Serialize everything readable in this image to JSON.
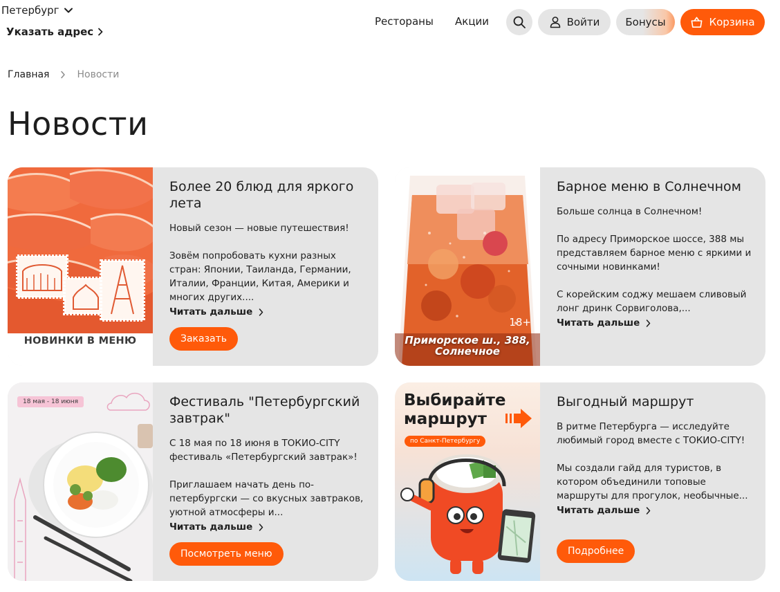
{
  "header": {
    "city": "Петербург",
    "address_link": "Указать адрес",
    "nav": {
      "restaurants": "Рестораны",
      "promos": "Акции"
    },
    "login": "Войти",
    "bonuses": "Бонусы",
    "cart": "Корзина"
  },
  "breadcrumb": {
    "home": "Главная",
    "current": "Новости"
  },
  "page_title": "Новости",
  "cards": [
    {
      "title": "Более 20 блюд для яркого лета",
      "paragraphs": [
        "Новый сезон — новые путешествия!",
        "Зовём попробовать кухни разных стран: Японии, Таиланда, Германии, Италии, Франции, Китая, Америки и многих других...."
      ],
      "read_more": "Читать дальше",
      "cta": "Заказать",
      "image_caption": "НОВИНКИ В МЕНЮ"
    },
    {
      "title": "Барное меню в Солнечном",
      "paragraphs": [
        "Больше солнца в Солнечном!",
        "По адресу Приморское шоссе, 388 мы представляем барное меню с яркими и сочными новинками!",
        "С корейским соджу мешаем сливовый лонг дринк Сорвиголова,..."
      ],
      "read_more": "Читать дальше",
      "image_caption": "Приморское ш., 388, Солнечное",
      "image_age": "18+"
    },
    {
      "title": "Фестиваль \"Петербургский завтрак\"",
      "paragraphs": [
        "С 18 мая по 18 июня в ТОКИО-CITY фестиваль «Петербургский завтрак»!",
        "Приглашаем начать день по-петербургски — со вкусных завтраков, уютной атмосферы и..."
      ],
      "read_more": "Читать дальше",
      "cta": "Посмотреть меню",
      "image_tag": "18 мая - 18 июня"
    },
    {
      "title": "Выгодный маршрут",
      "paragraphs": [
        "В ритме Петербурга — исследуйте любимый город вместе с ТОКИО-CITY!",
        "Мы создали гайд для туристов, в котором объединили топовые маршруты для прогулок, необычные..."
      ],
      "read_more": "Читать дальше",
      "cta": "Подробнее",
      "image_title": "Выбирайте маршрут",
      "image_tag": "по Санкт-Петербургу"
    }
  ],
  "colors": {
    "accent": "#ff5a0a",
    "card_background": "#e5e5e5",
    "muted_text": "#8b8b8b"
  }
}
